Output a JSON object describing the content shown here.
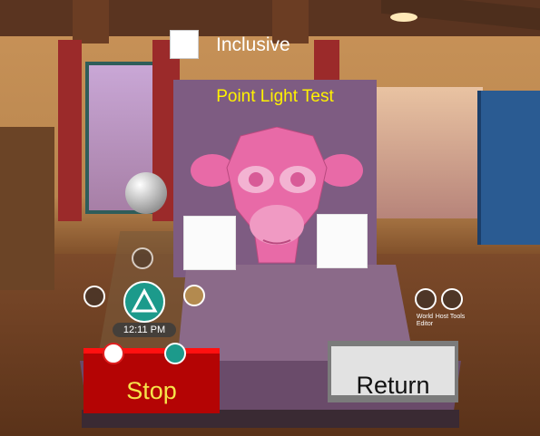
{
  "scene": {
    "checkbox_label": "Inclusive",
    "panel_title": "Point Light Test"
  },
  "buttons": {
    "stop": "Stop",
    "return": "Return"
  },
  "hud": {
    "time": "12:11 PM",
    "world_editor": "World Editor",
    "host_tools": "Host Tools"
  },
  "colors": {
    "title_yellow": "#fff200",
    "stop_red": "#b40404",
    "panel_purple": "#7e5c82",
    "monkey_pink": "#e86aa7",
    "teal": "#1c9a8b"
  }
}
